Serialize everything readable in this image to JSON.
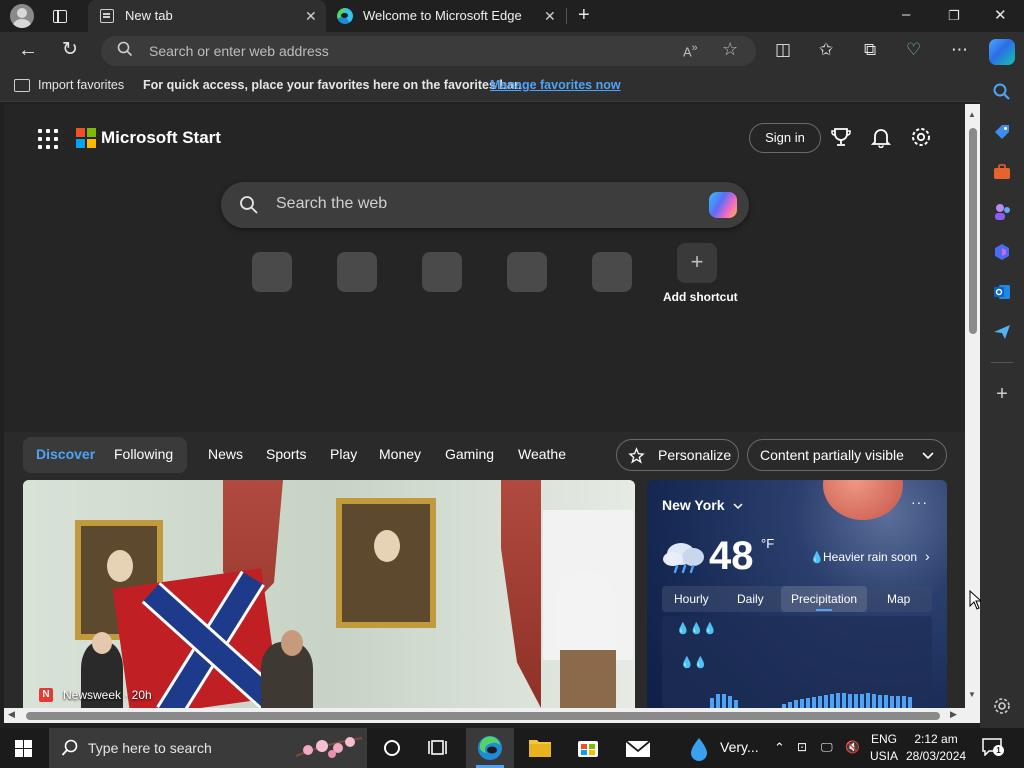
{
  "browser": {
    "tabs": [
      {
        "title": "New tab",
        "active": true
      },
      {
        "title": "Welcome to Microsoft Edge",
        "active": false
      }
    ],
    "address_placeholder": "Search or enter web address"
  },
  "favorites_bar": {
    "import_label": "Import favorites",
    "message": "For quick access, place your favorites here on the favorites bar.",
    "manage_link": "Manage favorites now"
  },
  "new_tab_page": {
    "brand": "Microsoft Start",
    "sign_in": "Sign in",
    "search_placeholder": "Search the web",
    "add_shortcut": "Add shortcut",
    "feed_tabs": [
      "Discover",
      "Following",
      "News",
      "Sports",
      "Play",
      "Money",
      "Gaming",
      "Weathe"
    ],
    "active_feed_tab": "Discover",
    "personalize": "Personalize",
    "content_visibility": "Content partially visible"
  },
  "news_card": {
    "source_badge": "N",
    "source": "Newsweek · 20h"
  },
  "weather": {
    "city": "New York",
    "temperature": "48",
    "unit": "°F",
    "alert": "Heavier rain soon",
    "tabs": [
      "Hourly",
      "Daily",
      "Precipitation",
      "Map"
    ],
    "active_tab": "Precipitation",
    "more": "···"
  },
  "taskbar": {
    "search_placeholder": "Type here to search",
    "weather_label": "Very...",
    "language_top": "ENG",
    "language_bottom": "USIA",
    "time": "2:12 am",
    "date": "28/03/2024",
    "notifications": "1"
  },
  "colors": {
    "accent": "#4fa3f7",
    "background": "#202020",
    "panel": "#2f2f2f"
  },
  "icons": [
    "profile-icon",
    "tab-actions-icon",
    "back-icon",
    "refresh-icon",
    "search-icon",
    "read-aloud-icon",
    "favorite-star-icon",
    "split-screen-icon",
    "favorites-icon",
    "collections-icon",
    "performance-icon",
    "more-icon",
    "copilot-icon"
  ]
}
